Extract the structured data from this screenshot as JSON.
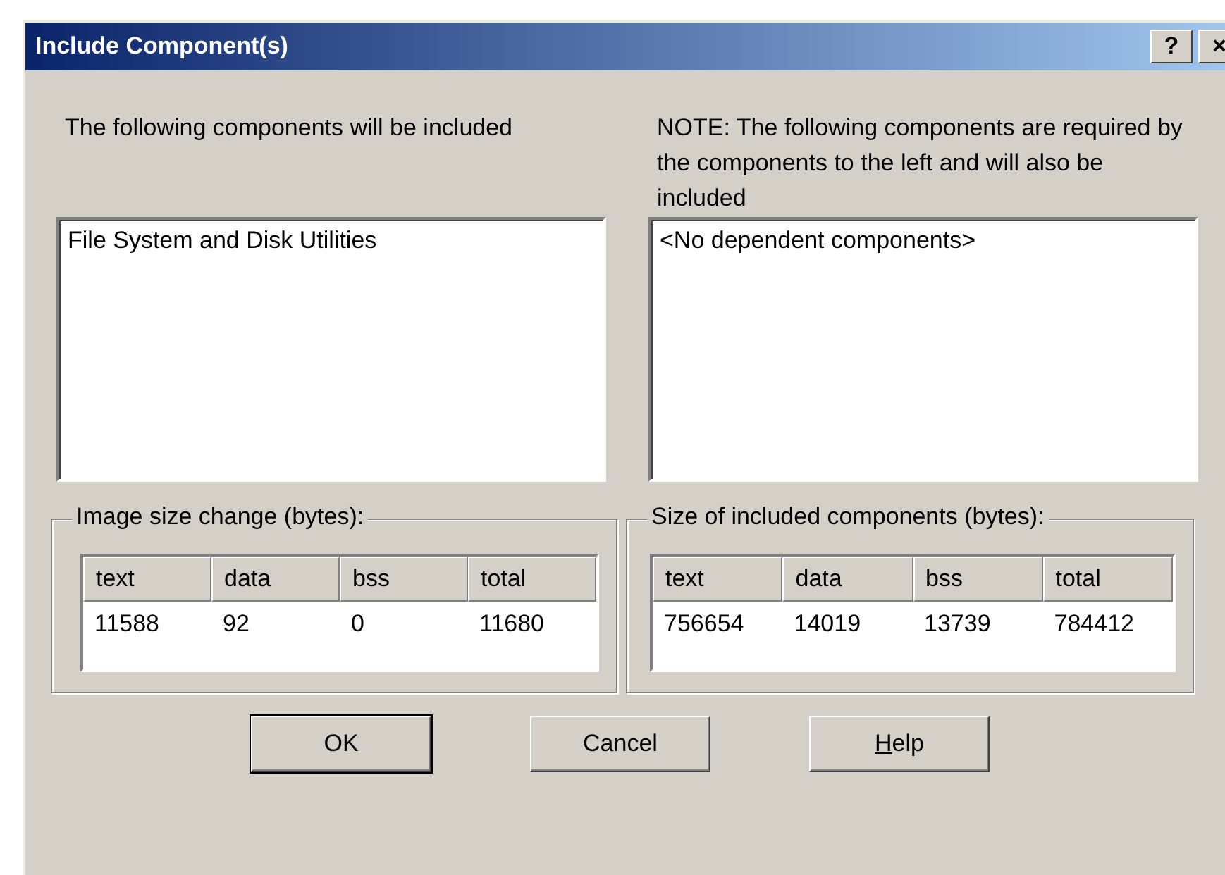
{
  "window": {
    "title": "Include Component(s)",
    "title_buttons": [
      "?",
      "×"
    ]
  },
  "left_panel": {
    "caption": "The following components will be included",
    "items": [
      "File System and Disk Utilities"
    ]
  },
  "right_panel": {
    "caption": "NOTE: The following components are required  by the components to the left and will also be included",
    "items": [
      "<No dependent components>"
    ]
  },
  "groups": [
    {
      "title": "Image size change (bytes):",
      "columns": [
        "text",
        "data",
        "bss",
        "total"
      ],
      "rows": [
        [
          "11588",
          "92",
          "0",
          "11680"
        ]
      ]
    },
    {
      "title": "Size of included components (bytes):",
      "columns": [
        "text",
        "data",
        "bss",
        "total"
      ],
      "rows": [
        [
          "756654",
          "14019",
          "13739",
          "784412"
        ]
      ]
    }
  ],
  "buttons": [
    {
      "label": "OK",
      "default": true,
      "underline_first": false
    },
    {
      "label": "Cancel",
      "default": false,
      "underline_first": false
    },
    {
      "label": "Help",
      "default": false,
      "underline_first": true
    }
  ]
}
